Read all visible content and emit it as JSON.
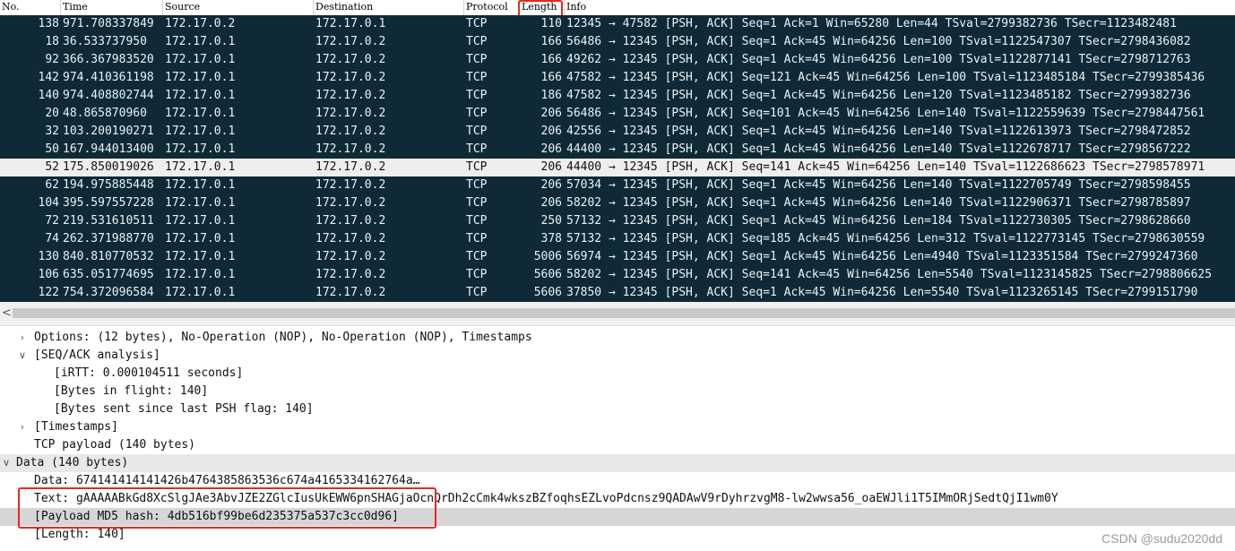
{
  "columns": [
    "No.",
    "Time",
    "Source",
    "Destination",
    "Protocol",
    "Length",
    "Info"
  ],
  "packets": [
    {
      "no": "138",
      "time": "971.708337849",
      "src": "172.17.0.2",
      "dst": "172.17.0.1",
      "proto": "TCP",
      "len": "110",
      "info": "12345 → 47582 [PSH, ACK] Seq=1 Ack=1 Win=65280 Len=44 TSval=2799382736 TSecr=1123482481"
    },
    {
      "no": "18",
      "time": "36.533737950",
      "src": "172.17.0.1",
      "dst": "172.17.0.2",
      "proto": "TCP",
      "len": "166",
      "info": "56486 → 12345 [PSH, ACK] Seq=1 Ack=45 Win=64256 Len=100 TSval=1122547307 TSecr=2798436082"
    },
    {
      "no": "92",
      "time": "366.367983520",
      "src": "172.17.0.1",
      "dst": "172.17.0.2",
      "proto": "TCP",
      "len": "166",
      "info": "49262 → 12345 [PSH, ACK] Seq=1 Ack=45 Win=64256 Len=100 TSval=1122877141 TSecr=2798712763"
    },
    {
      "no": "142",
      "time": "974.410361198",
      "src": "172.17.0.1",
      "dst": "172.17.0.2",
      "proto": "TCP",
      "len": "166",
      "info": "47582 → 12345 [PSH, ACK] Seq=121 Ack=45 Win=64256 Len=100 TSval=1123485184 TSecr=2799385436"
    },
    {
      "no": "140",
      "time": "974.408802744",
      "src": "172.17.0.1",
      "dst": "172.17.0.2",
      "proto": "TCP",
      "len": "186",
      "info": "47582 → 12345 [PSH, ACK] Seq=1 Ack=45 Win=64256 Len=120 TSval=1123485182 TSecr=2799382736"
    },
    {
      "no": "20",
      "time": "48.865870960",
      "src": "172.17.0.1",
      "dst": "172.17.0.2",
      "proto": "TCP",
      "len": "206",
      "info": "56486 → 12345 [PSH, ACK] Seq=101 Ack=45 Win=64256 Len=140 TSval=1122559639 TSecr=2798447561"
    },
    {
      "no": "32",
      "time": "103.200190271",
      "src": "172.17.0.1",
      "dst": "172.17.0.2",
      "proto": "TCP",
      "len": "206",
      "info": "42556 → 12345 [PSH, ACK] Seq=1 Ack=45 Win=64256 Len=140 TSval=1122613973 TSecr=2798472852"
    },
    {
      "no": "50",
      "time": "167.944013400",
      "src": "172.17.0.1",
      "dst": "172.17.0.2",
      "proto": "TCP",
      "len": "206",
      "info": "44400 → 12345 [PSH, ACK] Seq=1 Ack=45 Win=64256 Len=140 TSval=1122678717 TSecr=2798567222"
    },
    {
      "no": "52",
      "time": "175.850019026",
      "src": "172.17.0.1",
      "dst": "172.17.0.2",
      "proto": "TCP",
      "len": "206",
      "info": "44400 → 12345 [PSH, ACK] Seq=141 Ack=45 Win=64256 Len=140 TSval=1122686623 TSecr=2798578971",
      "selected": true
    },
    {
      "no": "62",
      "time": "194.975885448",
      "src": "172.17.0.1",
      "dst": "172.17.0.2",
      "proto": "TCP",
      "len": "206",
      "info": "57034 → 12345 [PSH, ACK] Seq=1 Ack=45 Win=64256 Len=140 TSval=1122705749 TSecr=2798598455"
    },
    {
      "no": "104",
      "time": "395.597557228",
      "src": "172.17.0.1",
      "dst": "172.17.0.2",
      "proto": "TCP",
      "len": "206",
      "info": "58202 → 12345 [PSH, ACK] Seq=1 Ack=45 Win=64256 Len=140 TSval=1122906371 TSecr=2798785897"
    },
    {
      "no": "72",
      "time": "219.531610511",
      "src": "172.17.0.1",
      "dst": "172.17.0.2",
      "proto": "TCP",
      "len": "250",
      "info": "57132 → 12345 [PSH, ACK] Seq=1 Ack=45 Win=64256 Len=184 TSval=1122730305 TSecr=2798628660"
    },
    {
      "no": "74",
      "time": "262.371988770",
      "src": "172.17.0.1",
      "dst": "172.17.0.2",
      "proto": "TCP",
      "len": "378",
      "info": "57132 → 12345 [PSH, ACK] Seq=185 Ack=45 Win=64256 Len=312 TSval=1122773145 TSecr=2798630559"
    },
    {
      "no": "130",
      "time": "840.810770532",
      "src": "172.17.0.1",
      "dst": "172.17.0.2",
      "proto": "TCP",
      "len": "5006",
      "info": "56974 → 12345 [PSH, ACK] Seq=1 Ack=45 Win=64256 Len=4940 TSval=1123351584 TSecr=2799247360"
    },
    {
      "no": "106",
      "time": "635.051774695",
      "src": "172.17.0.1",
      "dst": "172.17.0.2",
      "proto": "TCP",
      "len": "5606",
      "info": "58202 → 12345 [PSH, ACK] Seq=141 Ack=45 Win=64256 Len=5540 TSval=1123145825 TSecr=2798806625"
    },
    {
      "no": "122",
      "time": "754.372096584",
      "src": "172.17.0.1",
      "dst": "172.17.0.2",
      "proto": "TCP",
      "len": "5606",
      "info": "37850 → 12345 [PSH, ACK] Seq=1 Ack=45 Win=64256 Len=5540 TSval=1123265145 TSecr=2799151790"
    }
  ],
  "scrollbar": {
    "left_arrow": "<"
  },
  "detail": [
    {
      "text": "Options: (12 bytes), No-Operation (NOP), No-Operation (NOP), Timestamps",
      "level": 1,
      "toggle": "collapsed"
    },
    {
      "text": "[SEQ/ACK analysis]",
      "level": 1,
      "toggle": "expanded"
    },
    {
      "text": "[iRTT: 0.000104511 seconds]",
      "level": 2,
      "toggle": "none"
    },
    {
      "text": "[Bytes in flight: 140]",
      "level": 2,
      "toggle": "none"
    },
    {
      "text": "[Bytes sent since last PSH flag: 140]",
      "level": 2,
      "toggle": "none"
    },
    {
      "text": "[Timestamps]",
      "level": 1,
      "toggle": "collapsed"
    },
    {
      "text": "TCP payload (140 bytes)",
      "level": 1,
      "toggle": "none"
    },
    {
      "text": "Data (140 bytes)",
      "level": 0,
      "toggle": "expanded",
      "band": true
    },
    {
      "text": "Data: 674141414141426b4764385863536c674a4165334162764a…",
      "level": 1,
      "toggle": "none"
    },
    {
      "text": "Text: gAAAAABkGd8XcSlgJAe3AbvJZE2ZGlcIusUkEWW6pnSHAGjaOcnQrDh2cCmk4wkszBZfoqhsEZLvoPdcnsz9QADAwV9rDyhrzvgM8-lw2wwsa56_oaEWJli1T5IMmORjSedtQjI1wm0Y",
      "level": 1,
      "toggle": "none"
    },
    {
      "text": "[Payload MD5 hash: 4db516bf99be6d235375a537c3cc0d96]",
      "level": 1,
      "toggle": "none",
      "selected": true
    },
    {
      "text": "[Length: 140]",
      "level": 1,
      "toggle": "none"
    }
  ],
  "watermark": "CSDN @sudu2020dd",
  "colors": {
    "packet_bg": "#0f2a36",
    "packet_fg": "#e8f2f6",
    "selected_row": "#eeeeee",
    "highlight_box": "#e8281e"
  }
}
